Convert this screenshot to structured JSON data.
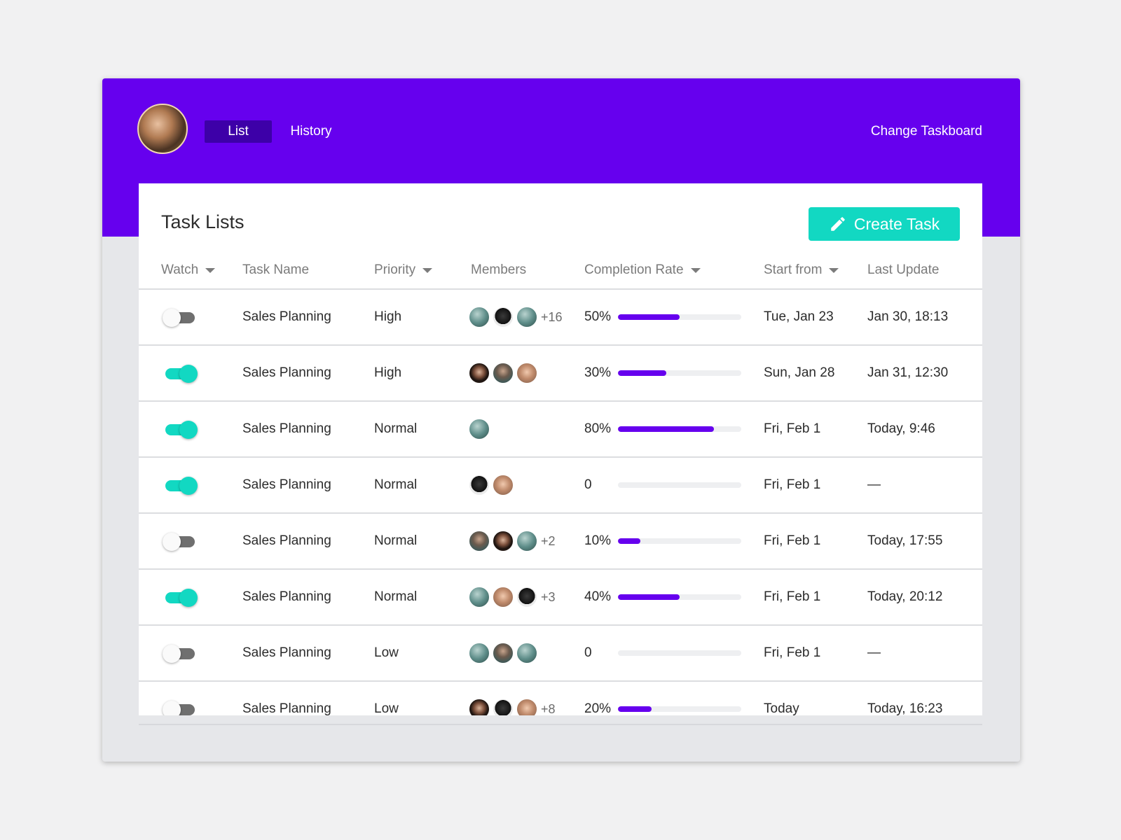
{
  "nav": {
    "tabs": [
      "List",
      "History"
    ],
    "active_tab": "List",
    "change_taskboard": "Change Taskboard"
  },
  "card": {
    "title": "Task Lists",
    "create_button": "Create Task"
  },
  "columns": {
    "watch": "Watch",
    "task_name": "Task Name",
    "priority": "Priority",
    "members": "Members",
    "completion_rate": "Completion Rate",
    "start_from": "Start from",
    "last_update": "Last Update"
  },
  "rows": [
    {
      "watch": false,
      "task": "Sales Planning",
      "priority": "High",
      "members": [
        "teal",
        "dog",
        "teal"
      ],
      "extra": "+16",
      "rate_label": "50%",
      "rate": 0.5,
      "start": "Tue, Jan 23",
      "update": "Jan 30, 18:13"
    },
    {
      "watch": true,
      "task": "Sales Planning",
      "priority": "High",
      "members": [
        "dark",
        "slate",
        "tan"
      ],
      "extra": "",
      "rate_label": "30%",
      "rate": 0.39,
      "start": "Sun, Jan 28",
      "update": "Jan 31, 12:30"
    },
    {
      "watch": true,
      "task": "Sales Planning",
      "priority": "Normal",
      "members": [
        "teal"
      ],
      "extra": "",
      "rate_label": "80%",
      "rate": 0.78,
      "start": "Fri, Feb 1",
      "update": "Today, 9:46"
    },
    {
      "watch": true,
      "task": "Sales Planning",
      "priority": "Normal",
      "members": [
        "dog",
        "tan"
      ],
      "extra": "",
      "rate_label": "0",
      "rate": 0,
      "start": "Fri, Feb 1",
      "update": "—"
    },
    {
      "watch": false,
      "task": "Sales Planning",
      "priority": "Normal",
      "members": [
        "slate",
        "dark",
        "teal"
      ],
      "extra": "+2",
      "rate_label": "10%",
      "rate": 0.18,
      "start": "Fri, Feb 1",
      "update": "Today, 17:55"
    },
    {
      "watch": true,
      "task": "Sales Planning",
      "priority": "Normal",
      "members": [
        "teal",
        "tan",
        "dog"
      ],
      "extra": "+3",
      "rate_label": "40%",
      "rate": 0.5,
      "start": "Fri, Feb 1",
      "update": "Today, 20:12"
    },
    {
      "watch": false,
      "task": "Sales Planning",
      "priority": "Low",
      "members": [
        "teal",
        "slate",
        "teal"
      ],
      "extra": "",
      "rate_label": "0",
      "rate": 0,
      "start": "Fri, Feb 1",
      "update": "—"
    },
    {
      "watch": false,
      "task": "Sales Planning",
      "priority": "Low",
      "members": [
        "dark",
        "dog",
        "tan"
      ],
      "extra": "+8",
      "rate_label": "20%",
      "rate": 0.27,
      "start": "Today",
      "update": "Today, 16:23"
    }
  ],
  "colors": {
    "header": "#6600ee",
    "active_tab": "#3d00a8",
    "accent": "#12d8c2",
    "progress": "#6600ee"
  },
  "icons": {
    "create_button": "pencil-icon",
    "sort": "caret-down-icon"
  }
}
